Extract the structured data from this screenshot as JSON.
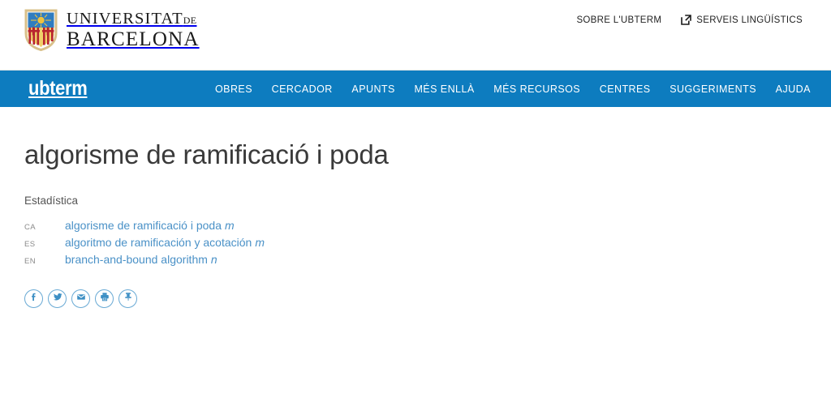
{
  "header": {
    "university_line1": "UNIVERSITAT",
    "university_line1_suffix": "DE",
    "university_line2": "BARCELONA",
    "logo_icon": "ub-shield-icon",
    "top_links": [
      {
        "label": "SOBRE L'UBTERM",
        "icon": null
      },
      {
        "label": "SERVEIS LINGÜÍSTICS",
        "icon": "external-link-icon"
      }
    ]
  },
  "nav": {
    "brand": "ubterm",
    "background_color": "#0d7cbf",
    "items": [
      {
        "label": "OBRES"
      },
      {
        "label": "CERCADOR"
      },
      {
        "label": "APUNTS"
      },
      {
        "label": "MÉS ENLLÀ"
      },
      {
        "label": "MÉS RECURSOS"
      },
      {
        "label": "CENTRES"
      },
      {
        "label": "SUGGERIMENTS"
      },
      {
        "label": "AJUDA"
      }
    ]
  },
  "main": {
    "title": "algorisme de ramificació i poda",
    "subject_area": "Estadística",
    "link_color": "#4a91c7",
    "terms": [
      {
        "lang": "CA",
        "term": "algorisme de ramificació i poda",
        "gender": "m"
      },
      {
        "lang": "ES",
        "term": "algoritmo de ramificación y acotación",
        "gender": "m"
      },
      {
        "lang": "EN",
        "term": "branch-and-bound algorithm",
        "gender": "n"
      }
    ]
  },
  "social": {
    "buttons": [
      {
        "name": "facebook-icon",
        "label": "Facebook"
      },
      {
        "name": "twitter-icon",
        "label": "Twitter"
      },
      {
        "name": "email-icon",
        "label": "Correu"
      },
      {
        "name": "print-icon",
        "label": "Imprimeix"
      },
      {
        "name": "pin-icon",
        "label": "Fixa"
      }
    ]
  }
}
